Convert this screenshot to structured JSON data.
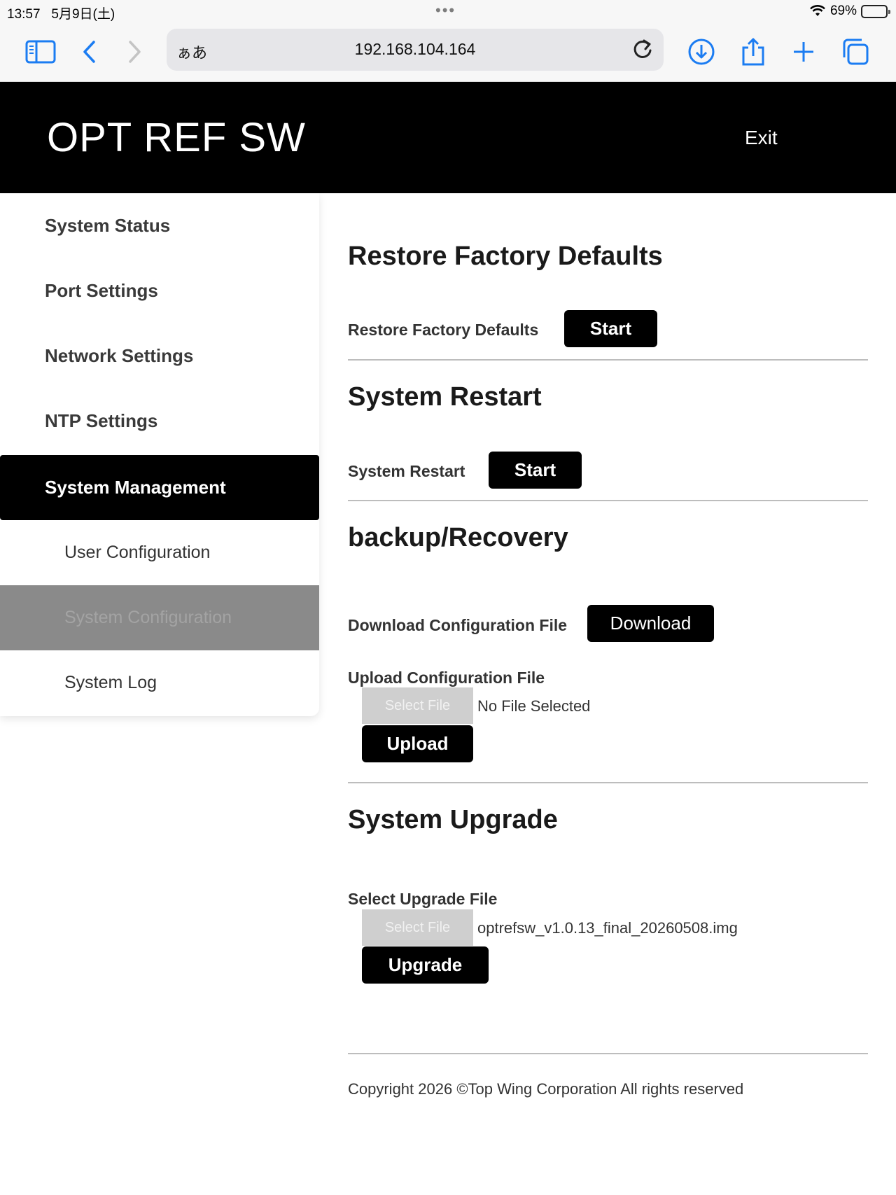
{
  "statusbar": {
    "time": "13:57",
    "date": "5月9日(土)",
    "battery_text": "69%",
    "battery_level": 0.69
  },
  "browser": {
    "reader_label": "ぁあ",
    "url": "192.168.104.164",
    "icons": [
      "sidebar-icon",
      "back-icon",
      "forward-icon",
      "reload-icon",
      "download-icon",
      "share-icon",
      "new-tab-icon",
      "tabs-icon"
    ]
  },
  "header": {
    "title": "OPT REF SW",
    "exit_label": "Exit"
  },
  "sidebar": {
    "items": [
      {
        "label": "System Status"
      },
      {
        "label": "Port Settings"
      },
      {
        "label": "Network Settings"
      },
      {
        "label": "NTP Settings"
      },
      {
        "label": "System Management"
      },
      {
        "label": "User Configuration"
      },
      {
        "label": "System Configuration"
      },
      {
        "label": "System Log"
      }
    ]
  },
  "main": {
    "restore": {
      "title": "Restore Factory Defaults",
      "label": "Restore Factory Defaults",
      "button": "Start"
    },
    "restart": {
      "title": "System Restart",
      "label": "System Restart",
      "button": "Start"
    },
    "backup": {
      "title": "backup/Recovery",
      "download_label": "Download Configuration File",
      "download_button": "Download",
      "upload_label": "Upload Configuration File",
      "select_file_button": "Select File",
      "selected_file": "No File Selected",
      "upload_button": "Upload"
    },
    "upgrade": {
      "title": "System Upgrade",
      "select_label": "Select Upgrade File",
      "select_file_button": "Select File",
      "selected_file": "optrefsw_v1.0.13_final_20260508.img",
      "upgrade_button": "Upgrade"
    },
    "copyright": "Copyright 2026 ©Top Wing Corporation All rights reserved"
  }
}
